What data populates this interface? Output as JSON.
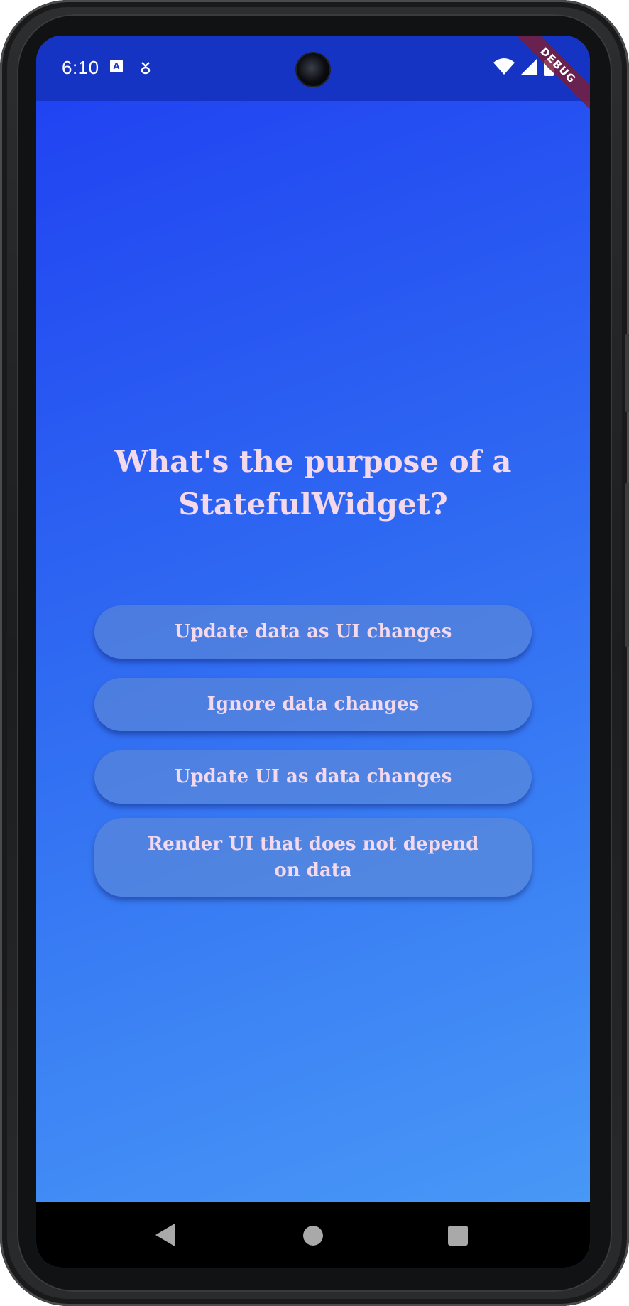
{
  "status_bar": {
    "time": "6:10",
    "debug_label": "DEBUG"
  },
  "quiz": {
    "question": "What's the purpose of a StatefulWidget?",
    "answers": [
      "Update data as UI changes",
      "Ignore data changes",
      "Update UI as data changes",
      "Render UI that does not depend on data"
    ]
  },
  "colors": {
    "gradient_start": "#1f3ff2",
    "gradient_end": "#4a9cf7",
    "text": "#f4d9ec",
    "status_bar": "#1634c4"
  },
  "icons": [
    "text-app-icon",
    "download-notification-icon",
    "wifi-icon",
    "signal-icon",
    "battery-icon",
    "back-icon",
    "home-icon",
    "recents-icon"
  ]
}
